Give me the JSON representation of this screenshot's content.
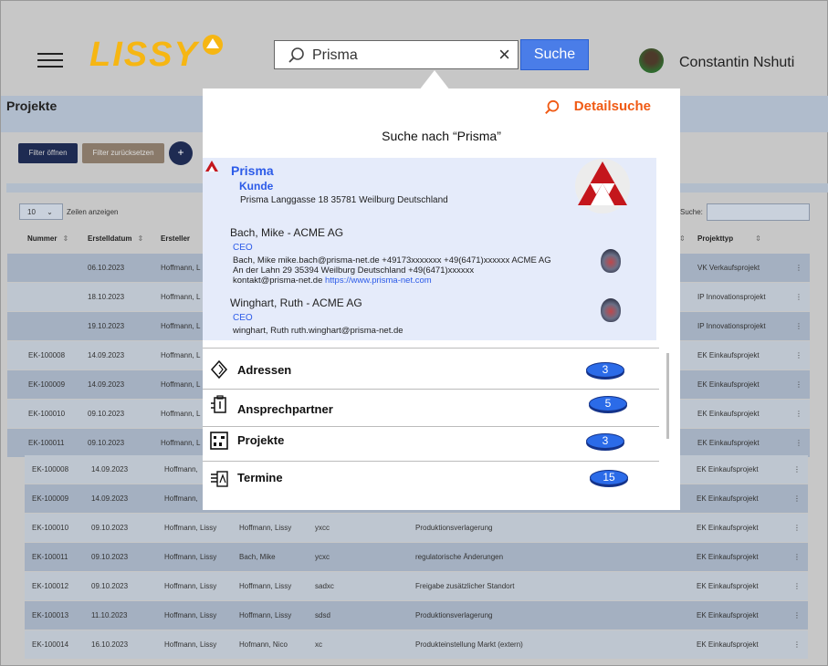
{
  "header": {
    "app_name": "LISSY",
    "search_value": "Prisma",
    "clear_label": "×",
    "search_button": "Suche",
    "user_name": "Constantin Nshuti"
  },
  "background": {
    "section_title": "Projekte",
    "btn_filter_open": "Filter öffnen",
    "btn_filter_reset": "Filter zurücksetzen",
    "btn_add": "+",
    "page_length": "10",
    "page_length_label": "Zeilen anzeigen",
    "search_label": "Suche:",
    "columns": {
      "nummer": "Nummer",
      "erstelldatum": "Erstelldatum",
      "ersteller": "Ersteller",
      "projekttyp": "Projekttyp"
    },
    "rows": [
      {
        "nummer": "",
        "datum": "06.10.2023",
        "ersteller": "Hoffmann, L",
        "typ": "VK Verkaufsprojekt"
      },
      {
        "nummer": "",
        "datum": "18.10.2023",
        "ersteller": "Hoffmann, L",
        "typ": "IP Innovationsprojekt"
      },
      {
        "nummer": "",
        "datum": "19.10.2023",
        "ersteller": "Hoffmann, L",
        "typ": "IP Innovationsprojekt"
      },
      {
        "nummer": "EK-100008",
        "datum": "14.09.2023",
        "ersteller": "Hoffmann, L",
        "typ": "EK Einkaufsprojekt"
      },
      {
        "nummer": "EK-100009",
        "datum": "14.09.2023",
        "ersteller": "Hoffmann, L",
        "typ": "EK Einkaufsprojekt"
      },
      {
        "nummer": "EK-100010",
        "datum": "09.10.2023",
        "ersteller": "Hoffmann, L",
        "typ": "EK Einkaufsprojekt"
      },
      {
        "nummer": "EK-100011",
        "datum": "09.10.2023",
        "ersteller": "Hoffmann, L",
        "typ": "EK Einkaufsprojekt"
      }
    ],
    "rows2": [
      {
        "nummer": "EK-100008",
        "datum": "14.09.2023",
        "ersteller": "Hoffmann,",
        "verantw": "",
        "kurz": "",
        "beschr": "",
        "typ": "EK Einkaufsprojekt"
      },
      {
        "nummer": "EK-100009",
        "datum": "14.09.2023",
        "ersteller": "Hoffmann,",
        "verantw": "",
        "kurz": "",
        "beschr": "",
        "typ": "EK Einkaufsprojekt"
      },
      {
        "nummer": "EK-100010",
        "datum": "09.10.2023",
        "ersteller": "Hoffmann, Lissy",
        "verantw": "Hoffmann, Lissy",
        "kurz": "yxcc",
        "beschr": "Produktionsverlagerung",
        "typ": "EK Einkaufsprojekt"
      },
      {
        "nummer": "EK-100011",
        "datum": "09.10.2023",
        "ersteller": "Hoffmann, Lissy",
        "verantw": "Bach, Mike",
        "kurz": "ycxc",
        "beschr": "regulatorische Änderungen",
        "typ": "EK Einkaufsprojekt"
      },
      {
        "nummer": "EK-100012",
        "datum": "09.10.2023",
        "ersteller": "Hoffmann, Lissy",
        "verantw": "Hoffmann, Lissy",
        "kurz": "sadxc",
        "beschr": "Freigabe zusätzlicher Standort",
        "typ": "EK Einkaufsprojekt"
      },
      {
        "nummer": "EK-100013",
        "datum": "11.10.2023",
        "ersteller": "Hoffmann, Lissy",
        "verantw": "Hoffmann, Lissy",
        "kurz": "sdsd",
        "beschr": "Produktionsverlagerung",
        "typ": "EK Einkaufsprojekt"
      },
      {
        "nummer": "EK-100014",
        "datum": "16.10.2023",
        "ersteller": "Hoffmann, Lissy",
        "verantw": "Hofmann, Nico",
        "kurz": "xc",
        "beschr": "Produkteinstellung Markt (extern)",
        "typ": "EK Einkaufsprojekt"
      }
    ],
    "row_menu": "⋮",
    "sort_glyph": "⇕"
  },
  "popup": {
    "detail_search": "Detailsuche",
    "heading": "Suche nach “Prisma”",
    "company": {
      "name": "Prisma",
      "type": "Kunde",
      "address": "Prisma Langgasse 18 35781 Weilburg Deutschland"
    },
    "contacts": [
      {
        "name": "Bach, Mike - ACME AG",
        "role": "CEO",
        "line1": "Bach, Mike mike.bach@prisma-net.de +49173xxxxxxx +49(6471)xxxxxx ACME AG",
        "line2": "An der Lahn 29 35394 Weilburg Deutschland +49(6471)xxxxxx",
        "line3_prefix": "kontakt@prisma-net.de ",
        "line3_link": "https://www.prisma-net.com"
      },
      {
        "name": "Winghart, Ruth - ACME AG",
        "role": "CEO",
        "line1": "winghart, Ruth ruth.winghart@prisma-net.de"
      }
    ],
    "categories": [
      {
        "label": "Adressen",
        "count": "3",
        "icon": "diamond-icon"
      },
      {
        "label": "Ansprechpartner",
        "count": "5",
        "icon": "contact-card-icon"
      },
      {
        "label": "Projekte",
        "count": "3",
        "icon": "project-board-icon"
      },
      {
        "label": "Termine",
        "count": "15",
        "icon": "calendar-list-icon"
      }
    ]
  },
  "colors": {
    "logo": "#f6b613",
    "accent_blue": "#2c5be8",
    "detail_orange": "#f05a14",
    "badge_blue": "#2b6be8",
    "prisma_red": "#c4161c"
  }
}
